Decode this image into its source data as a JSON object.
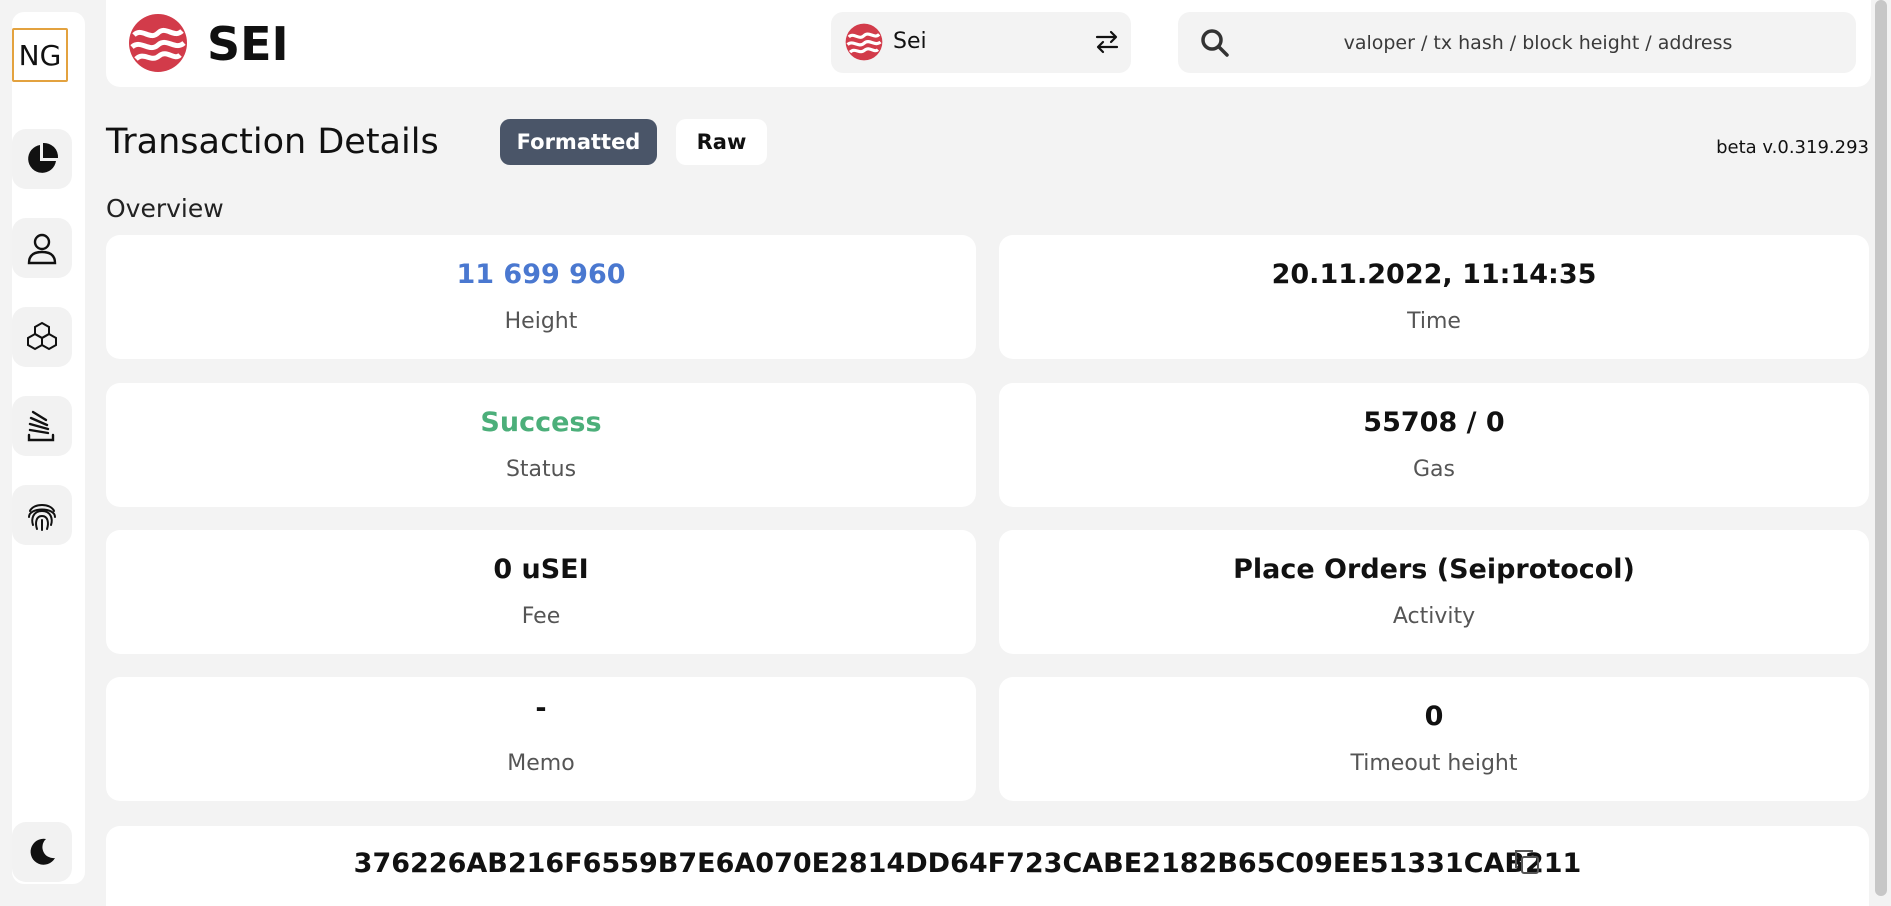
{
  "sidebar": {
    "logo_text": "NG",
    "items": [
      {
        "icon": "pie-chart-icon"
      },
      {
        "icon": "user-icon"
      },
      {
        "icon": "cubes-icon"
      },
      {
        "icon": "stack-icon"
      },
      {
        "icon": "fingerprint-icon"
      }
    ],
    "theme_icon": "moon-icon"
  },
  "header": {
    "brand_name": "SEI",
    "chain_select": {
      "value": "Sei"
    },
    "search": {
      "placeholder": "valoper / tx hash / block height / address"
    }
  },
  "page": {
    "title": "Transaction Details",
    "tabs": {
      "formatted": "Formatted",
      "raw": "Raw"
    },
    "active_tab": "Formatted",
    "version": "beta v.0.319.293",
    "section_title": "Overview"
  },
  "overview": {
    "height": {
      "value": "11 699 960",
      "label": "Height"
    },
    "time": {
      "value": "20.11.2022, 11:14:35",
      "label": "Time"
    },
    "status": {
      "value": "Success",
      "label": "Status"
    },
    "gas": {
      "value": "55708 / 0",
      "label": "Gas"
    },
    "fee": {
      "value": "0 uSEI",
      "label": "Fee"
    },
    "activity": {
      "value": "Place Orders (Seiprotocol)",
      "label": "Activity"
    },
    "memo": {
      "value": "-",
      "label": "Memo"
    },
    "timeout_height": {
      "value": "0",
      "label": "Timeout height"
    }
  },
  "tx_hash": "376226AB216F6559B7E6A070E2814DD64F723CABE2182B65C09EE51331CAB211",
  "colors": {
    "accent_dark": "#4a5568",
    "link_blue": "#4a78d0",
    "success_green": "#4caf7a",
    "logo_red": "#d23b4a",
    "ng_border": "#e3a23f"
  }
}
